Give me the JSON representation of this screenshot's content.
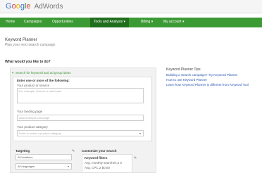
{
  "header": {
    "logo_letters": [
      "G",
      "o",
      "o",
      "g",
      "l",
      "e"
    ],
    "logo_suffix": "AdWords"
  },
  "nav": {
    "tabs": [
      {
        "label": "Home"
      },
      {
        "label": "Campaigns"
      },
      {
        "label": "Opportunities"
      },
      {
        "label": "Tools and Analysis ▾"
      },
      {
        "label": "Billing ▾"
      },
      {
        "label": "My account ▾"
      }
    ],
    "active_index": 3
  },
  "page": {
    "title": "Keyword Planner",
    "subtitle": "Plan your next search campaign",
    "question": "What would you like to do?"
  },
  "form": {
    "option_link": "Search for keyword and ad group ideas",
    "section_heading": "Enter one or more of the following:",
    "product_label": "Your product or service",
    "product_placeholder": "For example, flowers or used cars",
    "landing_label": "Your landing page",
    "landing_placeholder": "www.example.com/page",
    "category_label": "Your product category",
    "category_placeholder": "Enter or select a product category",
    "targeting_label": "Targeting",
    "location_value": "All locations",
    "language_value": "All languages",
    "customize_label": "Customize your search",
    "keyword_filters_label": "Keyword filters",
    "filter_line1": "Avg. monthly searches ≥ 0",
    "filter_line2": "Avg. CPC ≥ $0.00"
  },
  "tips": {
    "title": "Keyword Planner Tips",
    "links": [
      "Building a Search campaign? Try Keyword Planner",
      "How to use Keyword Planner",
      "Learn how Keyword Planner is different from Keyword Tool"
    ]
  }
}
